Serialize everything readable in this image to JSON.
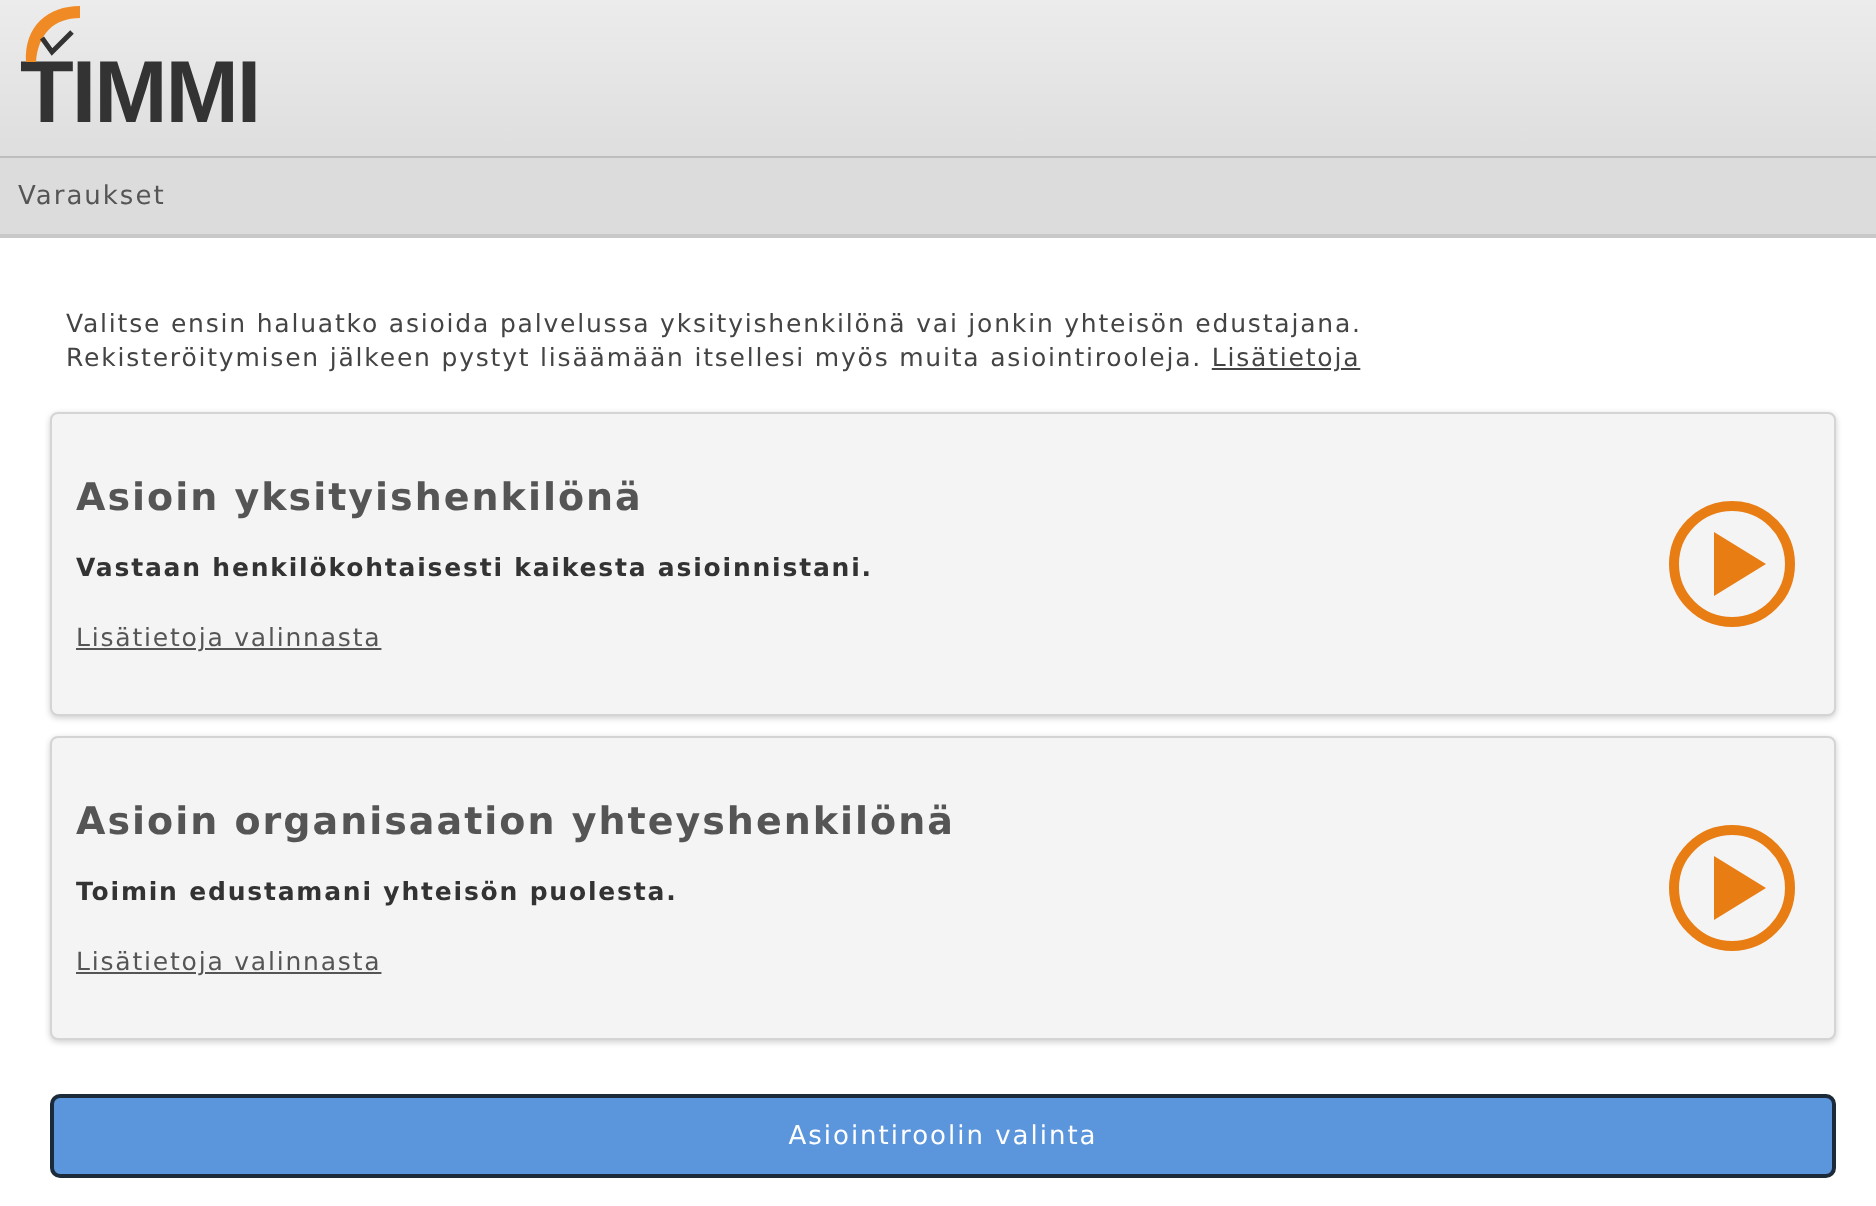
{
  "header": {
    "logo": "TIMMI"
  },
  "nav": {
    "items": [
      {
        "label": "Varaukset"
      }
    ]
  },
  "intro": {
    "lines": [
      "Valitse ensin haluatko asioida palvelussa yksityishenkilönä vai jonkin yhteisön edustajana.",
      "Rekisteröitymisen jälkeen pystyt lisäämään itsellesi myös muita asiointirooleja."
    ],
    "link": "Lisätietoja"
  },
  "options": [
    {
      "title": "Asioin yksityishenkilönä",
      "description": "Vastaan henkilökohtaisesti kaikesta asioinnistani.",
      "link": "Lisätietoja valinnasta"
    },
    {
      "title": "Asioin organisaation yhteyshenkilönä",
      "description": "Toimin edustamani yhteisön puolesta.",
      "link": "Lisätietoja valinnasta"
    }
  ],
  "button": {
    "label": "Asiointiroolin valinta"
  }
}
